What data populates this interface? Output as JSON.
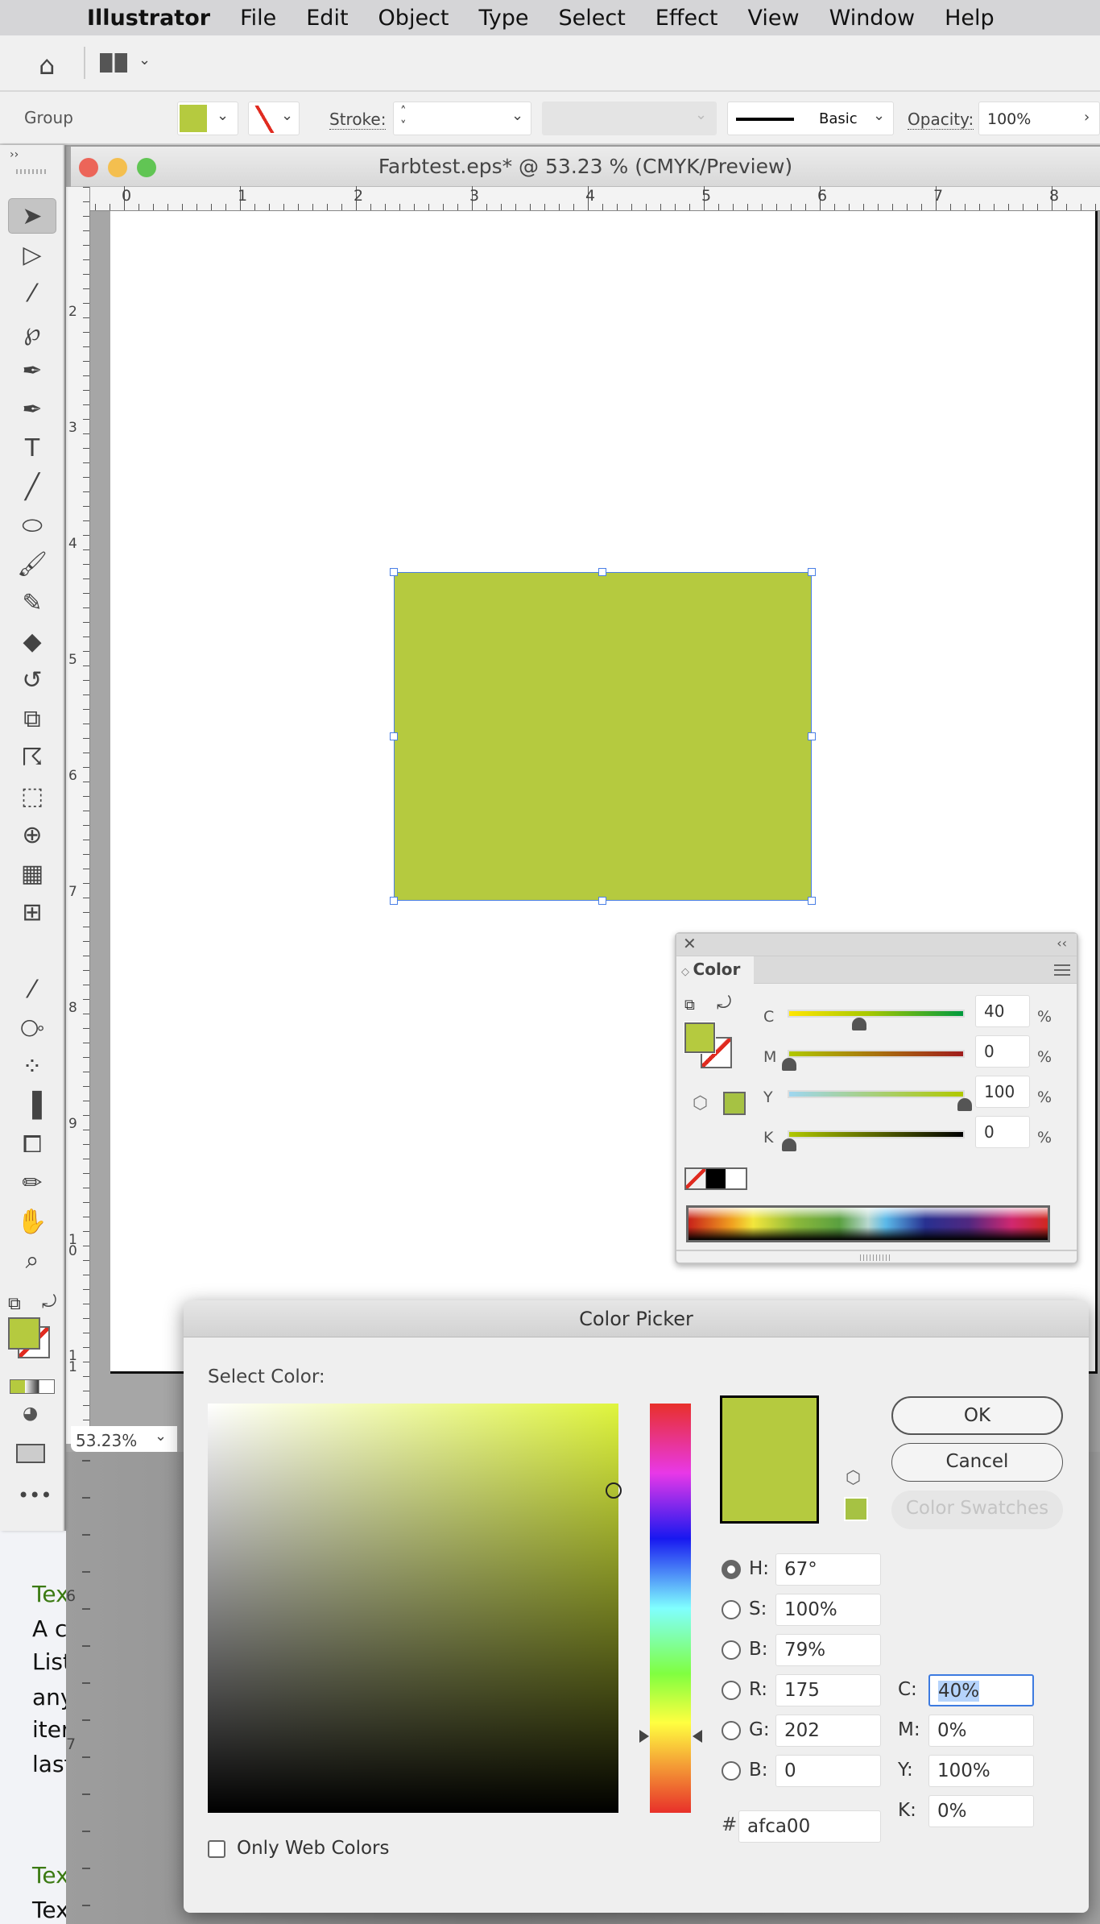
{
  "menubar": {
    "app": "Illustrator",
    "items": [
      "File",
      "Edit",
      "Object",
      "Type",
      "Select",
      "Effect",
      "View",
      "Window",
      "Help"
    ]
  },
  "control": {
    "selection": "Group",
    "stroke_label": "Stroke:",
    "brush": "Basic",
    "opacity_label": "Opacity:",
    "opacity": "100%",
    "fill_color": "#b5ca3f"
  },
  "document": {
    "title": "Farbtest.eps* @ 53.23 % (CMYK/Preview)",
    "zoom": "53.23%",
    "shape_color": "#b5ca3f",
    "hruler": [
      "0",
      "1",
      "2",
      "3",
      "4",
      "5",
      "6",
      "7",
      "8"
    ],
    "vruler": [
      "2",
      "3",
      "4",
      "5",
      "6",
      "7",
      "8",
      "9",
      "1\n0",
      "1\n1"
    ],
    "lower_ruler": [
      "6",
      "7"
    ]
  },
  "tools": [
    "selection",
    "direct-selection",
    "magic-wand",
    "lasso",
    "pen",
    "curvature",
    "type",
    "line-segment",
    "ellipse",
    "paintbrush",
    "shaper",
    "eraser",
    "rotate",
    "scale",
    "puppet-warp",
    "free-transform",
    "shape-builder",
    "perspective-grid",
    "mesh",
    "gradient",
    "eyedropper",
    "blend",
    "symbol-sprayer",
    "column-graph",
    "artboard",
    "slice",
    "hand",
    "zoom"
  ],
  "background_text": [
    "Tex",
    "A c",
    "List",
    "any",
    "iter",
    "last",
    "Tex",
    "Tex"
  ],
  "color_panel": {
    "title": "Color",
    "channels": [
      {
        "label": "C",
        "value": "40",
        "percent": 40
      },
      {
        "label": "M",
        "value": "0",
        "percent": 0
      },
      {
        "label": "Y",
        "value": "100",
        "percent": 100
      },
      {
        "label": "K",
        "value": "0",
        "percent": 0
      }
    ],
    "unit": "%"
  },
  "color_picker": {
    "title": "Color Picker",
    "select_label": "Select Color:",
    "ok": "OK",
    "cancel": "Cancel",
    "swatches": "Color Swatches",
    "web_only": "Only Web Colors",
    "hue": 67,
    "hsb": [
      {
        "label": "H:",
        "value": "67°",
        "selected": true
      },
      {
        "label": "S:",
        "value": "100%"
      },
      {
        "label": "B:",
        "value": "79%"
      },
      {
        "label": "R:",
        "value": "175"
      },
      {
        "label": "G:",
        "value": "202"
      },
      {
        "label": "B:",
        "value": "0"
      }
    ],
    "hex_label": "#",
    "hex": "afca00",
    "cmyk": [
      {
        "label": "C:",
        "value": "40%"
      },
      {
        "label": "M:",
        "value": "0%"
      },
      {
        "label": "Y:",
        "value": "100%"
      },
      {
        "label": "K:",
        "value": "0%"
      }
    ],
    "color": "#b5ca3f"
  }
}
